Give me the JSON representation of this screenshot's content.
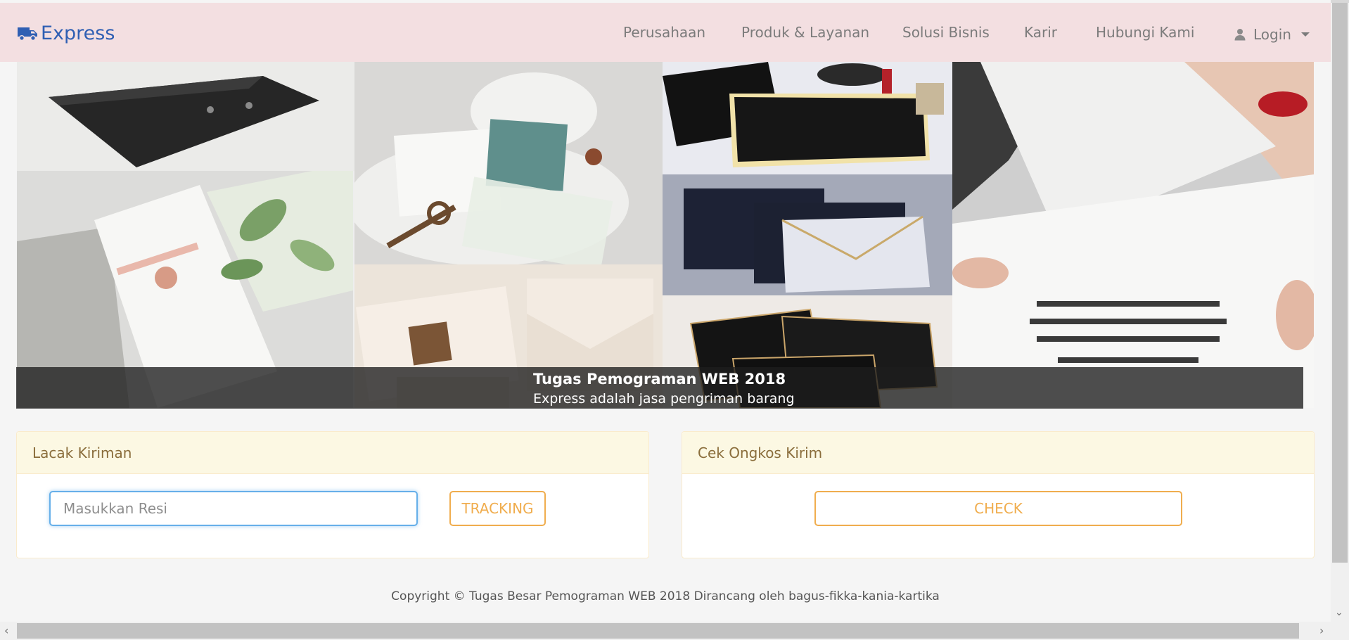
{
  "navbar": {
    "brand": "Express",
    "items": [
      "Perusahaan",
      "Produk & Layanan",
      "Solusi Bisnis",
      "Karir",
      "Hubungi Kami"
    ],
    "login_label": "Login"
  },
  "hero": {
    "caption_title": "Tugas Pemograman WEB 2018",
    "caption_subtitle": "Express adalah jasa pengriman barang"
  },
  "tracking_panel": {
    "title": "Lacak Kiriman",
    "input_placeholder": "Masukkan Resi",
    "button_label": "TRACKING"
  },
  "shipping_panel": {
    "title": "Cek Ongkos Kirim",
    "button_label": "CHECK"
  },
  "footer": {
    "text": "Copyright © Tugas Besar Pemograman WEB 2018 Dirancang oleh bagus-fikka-kania-kartika"
  },
  "colors": {
    "navbar_bg": "#f3dfe1",
    "brand": "#2f5fb3",
    "panel_head_bg": "#fcf8e3",
    "panel_head_text": "#8a6d3b",
    "accent_orange": "#f0ad4e"
  },
  "icons": {
    "brand": "truck-icon",
    "login": "user-icon",
    "login_caret": "caret-down-icon"
  }
}
